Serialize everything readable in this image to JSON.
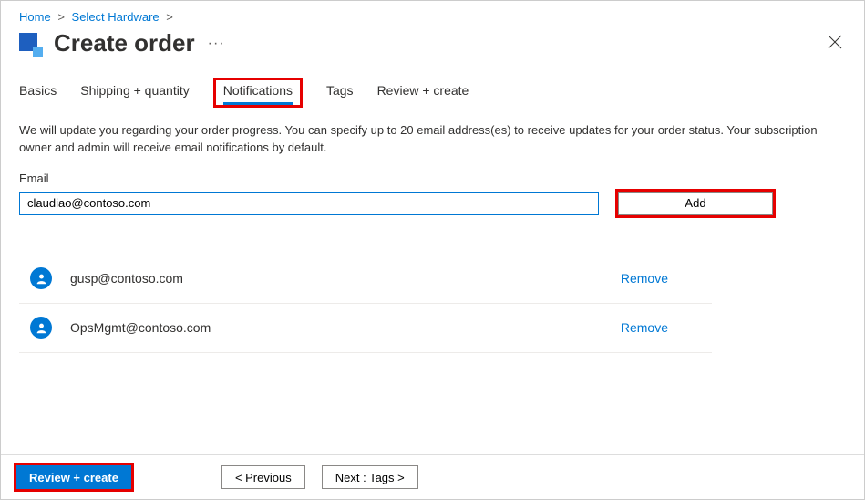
{
  "breadcrumb": {
    "home": "Home",
    "select_hardware": "Select Hardware"
  },
  "page": {
    "title": "Create order"
  },
  "tabs": {
    "basics": "Basics",
    "shipping": "Shipping + quantity",
    "notifications": "Notifications",
    "tags": "Tags",
    "review": "Review + create"
  },
  "description": "We will update you regarding your order progress. You can specify up to 20 email address(es) to receive updates for your order status. Your subscription owner and admin will receive email notifications by default.",
  "form": {
    "email_label": "Email",
    "email_value": "claudiao@contoso.com",
    "add_label": "Add"
  },
  "emails": [
    {
      "address": "gusp@contoso.com",
      "remove": "Remove"
    },
    {
      "address": "OpsMgmt@contoso.com",
      "remove": "Remove"
    }
  ],
  "footer": {
    "review_create": "Review + create",
    "previous": "<  Previous",
    "next": "Next : Tags  >"
  }
}
